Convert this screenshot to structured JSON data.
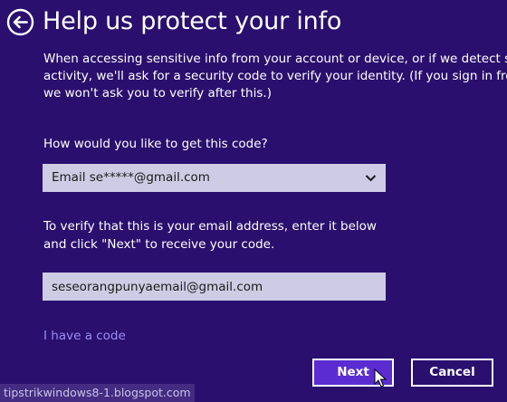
{
  "header": {
    "title": "Help us protect your info",
    "back_icon": "back-arrow-circle-icon"
  },
  "description": {
    "line1": "When accessing sensitive info from your account or device, or if we detect sus",
    "line2": "activity, we'll ask for a security code to verify your identity. (If you sign in frequ",
    "line3": "we won't ask you to verify after this.)"
  },
  "method": {
    "question": "How would you like to get this code?",
    "selected": "Email se*****@gmail.com"
  },
  "verify": {
    "instruction_line1": "To verify that this is your email address, enter it below",
    "instruction_line2": "and click \"Next\" to receive your code.",
    "email_value": "seseorangpunyaemail@gmail.com"
  },
  "links": {
    "have_code": "I have a code"
  },
  "buttons": {
    "next": "Next",
    "cancel": "Cancel"
  },
  "watermark": {
    "text": "tipstrikwindows8-1.blogspot.com"
  },
  "colors": {
    "background": "#2a0f6e",
    "field_background": "#cecce4",
    "link": "#9a8ff0",
    "accent_button": "#5b2cd2"
  }
}
